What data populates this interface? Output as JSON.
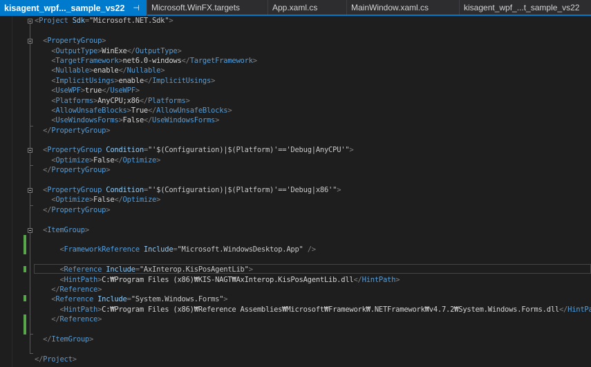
{
  "tabs": [
    {
      "label": "kisagent_wpf..._sample_vs22",
      "active": true,
      "pin": "⊣",
      "close": "✕"
    },
    {
      "label": "Microsoft.WinFX.targets",
      "active": false
    },
    {
      "label": "App.xaml.cs",
      "active": false
    },
    {
      "label": "MainWindow.xaml.cs",
      "active": false
    },
    {
      "label": "kisagent_wpf_...t_sample_vs22",
      "active": false
    }
  ],
  "colors": {
    "background": "#1e1e1e",
    "tag": "#569cd6",
    "text": "#d4d4d4",
    "attribute": "#92caf4",
    "active_tab": "#007acc",
    "change_marker": "#57a64a"
  },
  "code_lines": [
    "<Project Sdk=\"Microsoft.NET.Sdk\">",
    "",
    "  <PropertyGroup>",
    "    <OutputType>WinExe</OutputType>",
    "    <TargetFramework>net6.0-windows</TargetFramework>",
    "    <Nullable>enable</Nullable>",
    "    <ImplicitUsings>enable</ImplicitUsings>",
    "    <UseWPF>true</UseWPF>",
    "    <Platforms>AnyCPU;x86</Platforms>",
    "    <AllowUnsafeBlocks>True</AllowUnsafeBlocks>",
    "    <UseWindowsForms>False</UseWindowsForms>",
    "  </PropertyGroup>",
    "",
    "  <PropertyGroup Condition=\"'$(Configuration)|$(Platform)'=='Debug|AnyCPU'\">",
    "    <Optimize>False</Optimize>",
    "  </PropertyGroup>",
    "",
    "  <PropertyGroup Condition=\"'$(Configuration)|$(Platform)'=='Debug|x86'\">",
    "    <Optimize>False</Optimize>",
    "  </PropertyGroup>",
    "",
    "  <ItemGroup>",
    "",
    "      <FrameworkReference Include=\"Microsoft.WindowsDesktop.App\" />",
    "",
    "      <Reference Include=\"AxInterop.KisPosAgentLib\">",
    "      <HintPath>C:₩Program Files (x86)₩KIS-NAGT₩AxInterop.KisPosAgentLib.dll</HintPath>",
    "    </Reference>",
    "    <Reference Include=\"System.Windows.Forms\">",
    "      <HintPath>C:₩Program Files (x86)₩Reference Assemblies₩Microsoft₩Framework₩.NETFramework₩v4.7.2₩System.Windows.Forms.dll</HintPath>",
    "    </Reference>",
    "",
    "  </ItemGroup>",
    "",
    "</Project>"
  ]
}
